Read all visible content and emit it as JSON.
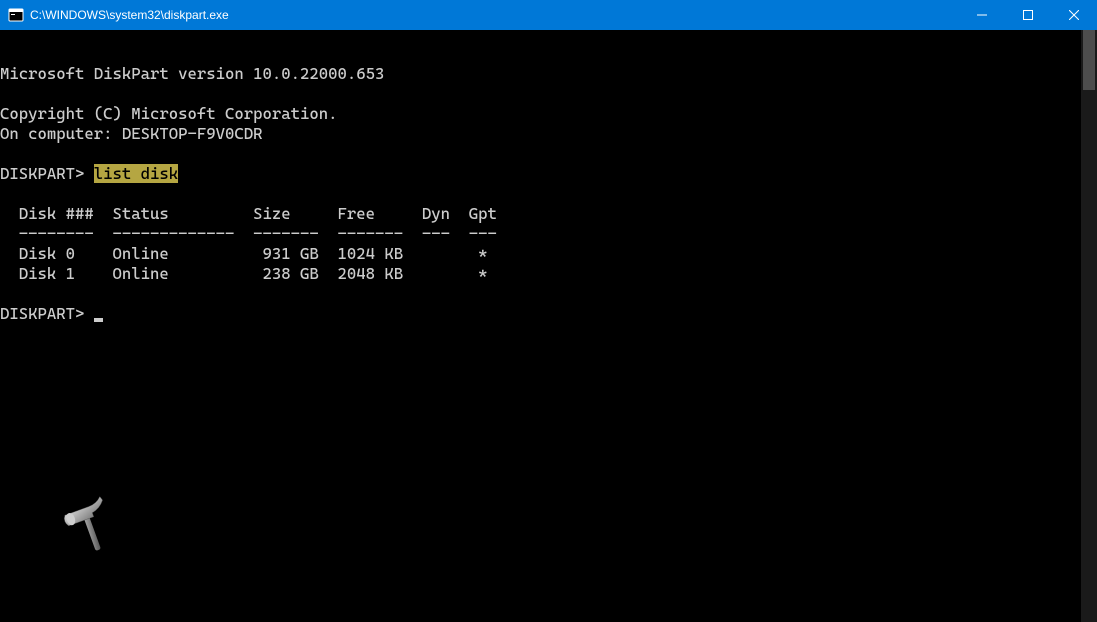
{
  "window": {
    "title": "C:\\WINDOWS\\system32\\diskpart.exe"
  },
  "terminal": {
    "version_line": "Microsoft DiskPart version 10.0.22000.653",
    "copyright_line": "Copyright (C) Microsoft Corporation.",
    "computer_line": "On computer: DESKTOP-F9V0CDR",
    "prompt1_prefix": "DISKPART> ",
    "prompt1_command": "list disk",
    "table": {
      "header": "  Disk ###  Status         Size     Free     Dyn  Gpt",
      "divider": "  --------  -------------  -------  -------  ---  ---",
      "rows": [
        "  Disk 0    Online          931 GB  1024 KB        *",
        "  Disk 1    Online          238 GB  2048 KB        *"
      ]
    },
    "prompt2_prefix": "DISKPART> "
  }
}
